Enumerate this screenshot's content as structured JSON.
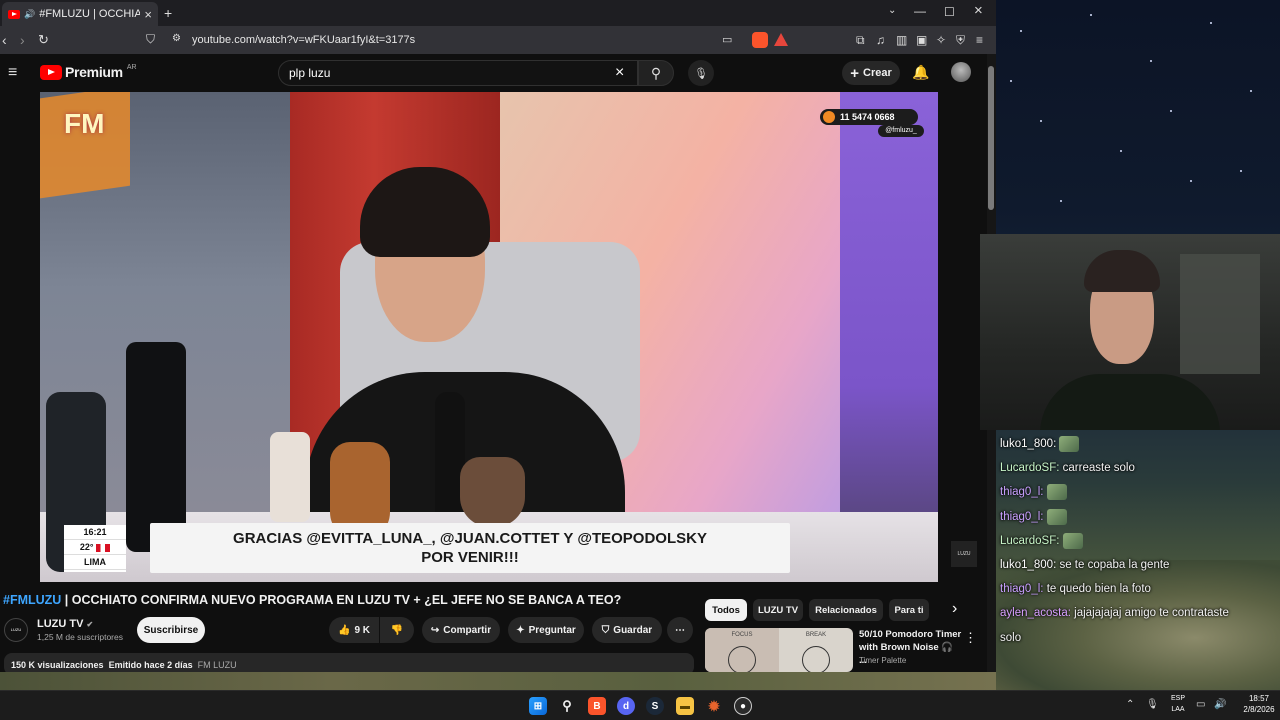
{
  "browser": {
    "tab_title": "#FMLUZU | OCCHIATO CONFI",
    "url": "youtube.com/watch?v=wFKUaar1fyI&t=3177s"
  },
  "youtube": {
    "logo_text": "Premium",
    "logo_region": "AR",
    "search_value": "plp luzu",
    "create_label": "Crear"
  },
  "video_overlay": {
    "caption_line1": "GRACIAS @EVITTA_LUNA_, @JUAN.COTTET Y @TEOPODOLSKY",
    "caption_line2": "POR VENIR!!!",
    "phone": "11 5474 0668",
    "handle": "@fmluzu_",
    "time": "16:21",
    "temp": "22°",
    "city": "LIMA",
    "fm_logo": "FM",
    "watermark": "LUZU"
  },
  "video": {
    "title_tag": "#FMLUZU",
    "title_rest": " | OCCHIATO CONFIRMA NUEVO PROGRAMA EN LUZU TV + ¿EL JEFE NO SE BANCA A TEO?",
    "channel": "LUZU TV",
    "subscribers": "1,25 M de suscriptores",
    "subscribe_label": "Suscribirse",
    "likes": "9 K",
    "share_label": "Compartir",
    "ask_label": "Preguntar",
    "save_label": "Guardar",
    "views": "150 K visualizaciones",
    "posted": "Emitido hace 2 días",
    "desc_link": "FM LUZU",
    "avatar_text": "LUZU"
  },
  "related": {
    "chips": [
      "Todos",
      "LUZU TV",
      "Relacionados",
      "Para ti"
    ],
    "item_title": "50/10 Pomodoro Timer with Brown Noise 🎧 ...",
    "item_channel": "Timer Palette",
    "thumb_focus": "FOCUS",
    "thumb_break": "BREAK"
  },
  "chat": [
    {
      "user": "luko1_800",
      "msg": "",
      "color": "#ffffff",
      "emote": true
    },
    {
      "user": "LucardoSF",
      "msg": "carreaste solo",
      "color": "#c8f5c8"
    },
    {
      "user": "thiag0_l",
      "msg": "",
      "color": "#c9a0ff",
      "emote": true
    },
    {
      "user": "thiag0_l",
      "msg": "",
      "color": "#c9a0ff",
      "emote": true
    },
    {
      "user": "LucardoSF",
      "msg": "",
      "color": "#c8f5c8",
      "emote": true
    },
    {
      "user": "luko1_800",
      "msg": "se te copaba la gente",
      "color": "#ffffff"
    },
    {
      "user": "thiag0_l",
      "msg": "te quedo bien la foto",
      "color": "#c9a0ff"
    },
    {
      "user": "aylen_acosta",
      "msg": "jajajajajaj amigo te contrataste",
      "color": "#d8a0ff"
    },
    {
      "user": "",
      "msg": "solo",
      "color": "#ffffff"
    }
  ],
  "taskbar": {
    "lang1": "ESP",
    "lang2": "LAA",
    "time": "18:57",
    "date": "2/8/2026"
  }
}
